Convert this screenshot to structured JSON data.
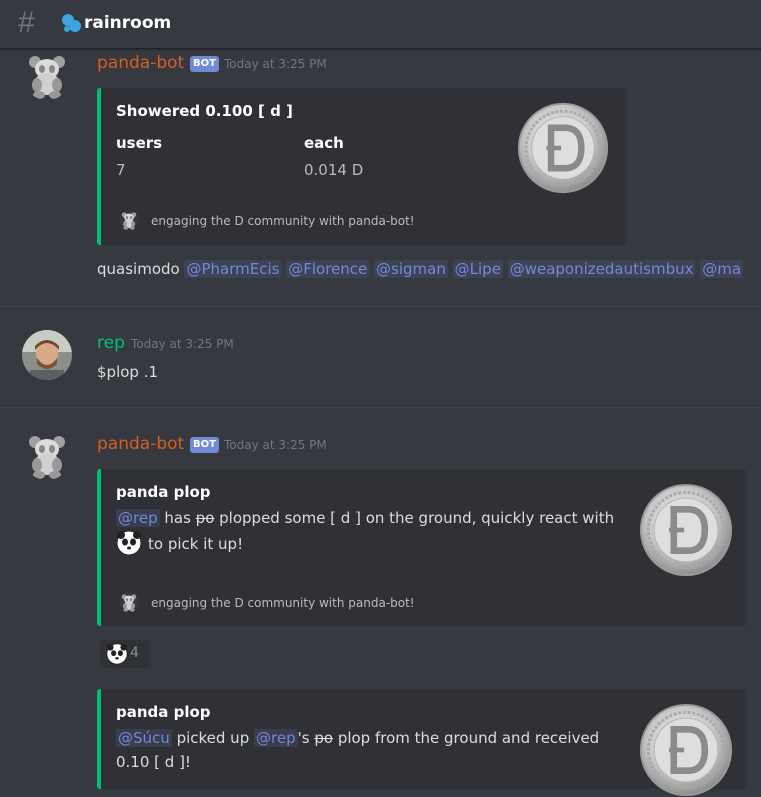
{
  "channel": {
    "name": "rainroom",
    "icon": "rain-icon",
    "hash_icon": "hash-icon"
  },
  "messages": [
    {
      "author": "panda-bot",
      "author_color": "#d65f20",
      "bot_tag": "BOT",
      "timestamp": "Today at 3:25 PM",
      "embed": {
        "title": "Showered 0.100 [ d ]",
        "fields": [
          {
            "name": "users",
            "value": "7"
          },
          {
            "name": "each",
            "value": "0.014 D"
          }
        ],
        "footer": "engaging the D community with panda-bot!",
        "thumbnail": "d-coin-image"
      },
      "text_prefix": "quasimodo",
      "mentions": [
        "@PharmEcis",
        "@Florence",
        "@sigman",
        "@Lipe",
        "@weaponizedautismbux",
        "@ma"
      ]
    },
    {
      "author": "rep",
      "author_color": "#00c078",
      "timestamp": "Today at 3:25 PM",
      "text": "$plop .1"
    },
    {
      "author": "panda-bot",
      "author_color": "#d65f20",
      "bot_tag": "BOT",
      "timestamp": "Today at 3:25 PM",
      "embed": {
        "title": "panda plop",
        "mention": "@rep",
        "text_1": "has",
        "strike": "po",
        "text_2": "plopped some [ d ] on the ground, quickly react with",
        "text_3": "to pick it up!",
        "footer": "engaging the D community with panda-bot!",
        "thumbnail": "d-coin-image"
      },
      "reaction": {
        "emoji": "panda-face-emoji",
        "count": "4"
      }
    },
    {
      "embed": {
        "title": "panda plop",
        "mention_1": "@Súcu",
        "text_1": "picked up",
        "mention_2": "@rep",
        "text_2": "'s",
        "strike": "po",
        "text_3": "plop from the ground and received",
        "text_4": "0.10 [ d ]!",
        "thumbnail": "d-coin-image"
      }
    }
  ],
  "colors": {
    "background": "#36393f",
    "embed_bg": "#2f3136",
    "embed_accent": "#00c078",
    "mention": "#7289da",
    "bot_tag": "#7289da"
  }
}
